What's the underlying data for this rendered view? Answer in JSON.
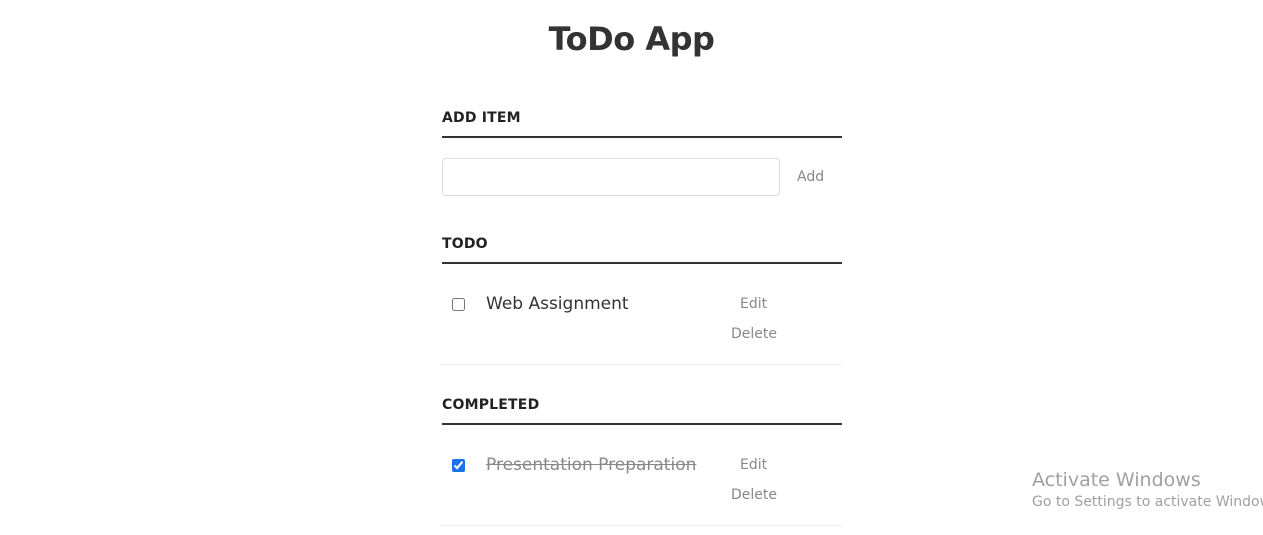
{
  "app": {
    "title": "ToDo App"
  },
  "add_item": {
    "heading": "ADD ITEM",
    "input_value": "",
    "add_label": "Add"
  },
  "todo": {
    "heading": "TODO",
    "items": [
      {
        "label": "Web Assignment",
        "checked": false,
        "edit_label": "Edit",
        "delete_label": "Delete"
      }
    ]
  },
  "completed": {
    "heading": "COMPLETED",
    "items": [
      {
        "label": "Presentation Preparation",
        "checked": true,
        "edit_label": "Edit",
        "delete_label": "Delete"
      }
    ]
  },
  "watermark": {
    "title": "Activate Windows",
    "subtitle": "Go to Settings to activate Windows."
  },
  "colors": {
    "text": "#333333",
    "muted": "#888888",
    "checkbox_accent": "#1a73e8"
  }
}
